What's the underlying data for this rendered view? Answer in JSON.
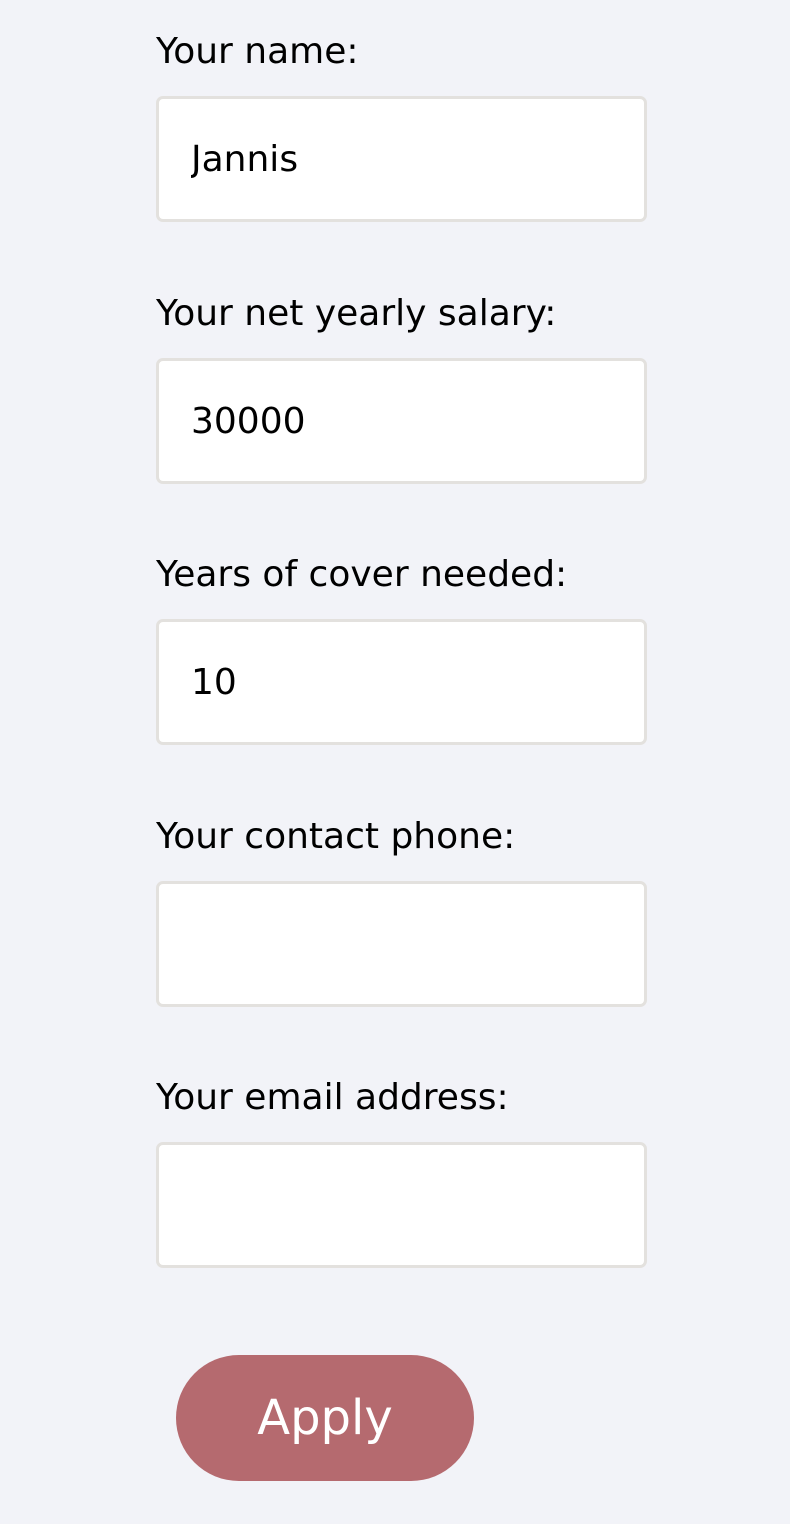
{
  "form": {
    "fields": [
      {
        "label": "Your name:",
        "value": "Jannis",
        "placeholder": ""
      },
      {
        "label": "Your net yearly salary:",
        "value": "30000",
        "placeholder": ""
      },
      {
        "label": "Years of cover needed:",
        "value": "10",
        "placeholder": ""
      },
      {
        "label": "Your contact phone:",
        "value": "",
        "placeholder": ""
      },
      {
        "label": "Your email address:",
        "value": "",
        "placeholder": ""
      }
    ],
    "submit_label": "Apply"
  },
  "colors": {
    "background": "#f2f3f8",
    "input_border": "#e3e1de",
    "button": "#b56a6f",
    "button_text": "#ffffff"
  }
}
